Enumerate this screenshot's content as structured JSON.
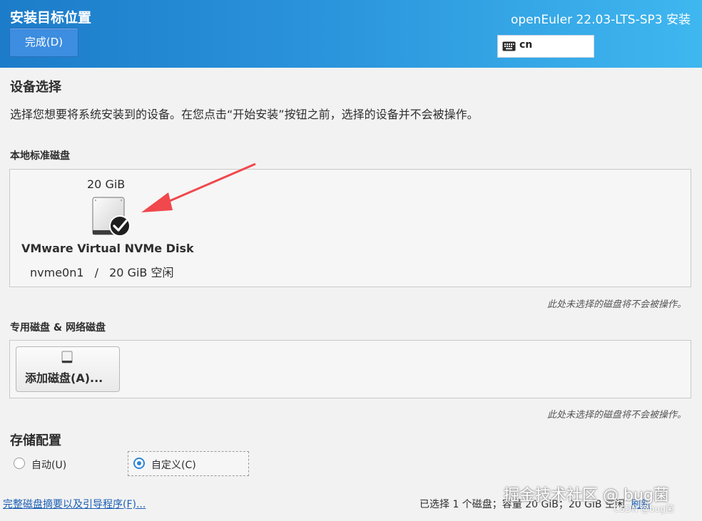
{
  "header": {
    "page_title": "安装目标位置",
    "done_label": "完成(D)",
    "product_title": "openEuler 22.03-LTS-SP3 安装",
    "keyboard_layout": "cn",
    "keyboard_icon": "keyboard-icon"
  },
  "device_selection": {
    "title": "设备选择",
    "description": "选择您想要将系统安装到的设备。在您点击“开始安装”按钮之前，选择的设备并不会被操作。"
  },
  "local_disks": {
    "heading": "本地标准磁盘",
    "disks": [
      {
        "size": "20 GiB",
        "name": "VMware Virtual NVMe Disk",
        "device": "nvme0n1",
        "separator": "/",
        "free": "20 GiB 空闲",
        "selected": true,
        "icon": "hard-disk-icon"
      }
    ],
    "note": "此处未选择的磁盘将不会被操作。"
  },
  "special_disks": {
    "heading": "专用磁盘 & 网络磁盘",
    "add_label": "添加磁盘(A)...",
    "note": "此处未选择的磁盘将不会被操作。"
  },
  "storage_config": {
    "title": "存储配置",
    "options": [
      {
        "label": "自动(U)",
        "selected": false
      },
      {
        "label": "自定义(C)",
        "selected": true
      }
    ]
  },
  "footer": {
    "summary_link": "完整磁盘摘要以及引导程序(F)...",
    "status": "已选择 1 个磁盘；容量 20 GiB；20 GiB 空闲",
    "refresh_link": "刷新"
  },
  "watermark": {
    "main": "掘金技术社区 @ bug菌",
    "small": "CSDN @bug菌"
  },
  "colors": {
    "header_start": "#1c7cc9",
    "header_end": "#3fb7ef",
    "accent": "#2d84d8",
    "link": "#1a5fb4",
    "annotation_arrow": "#f0484d"
  }
}
